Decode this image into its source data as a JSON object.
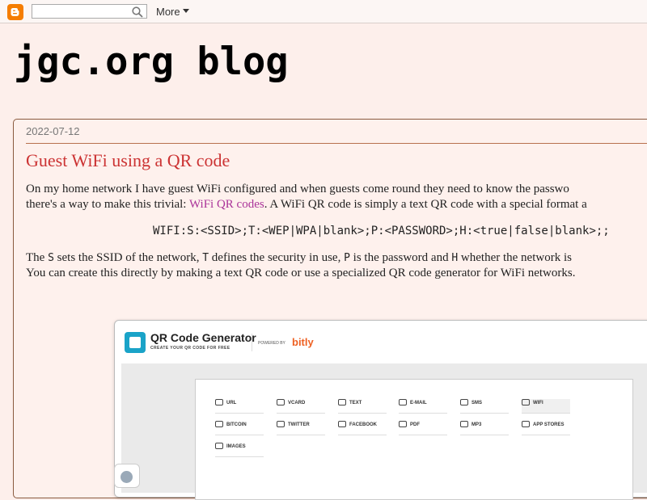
{
  "navbar": {
    "logo_icon": "blogger-icon",
    "search_placeholder": "",
    "more_label": "More"
  },
  "header": {
    "title": "jgc.org blog"
  },
  "post": {
    "date": "2022-07-12",
    "title": "Guest WiFi using a QR code",
    "p1_line1": "On my home network I have guest WiFi configured and when guests come round they need to know the passwo",
    "p1_line2_before": "there's a way to make this trivial: ",
    "p1_link": "WiFi QR codes",
    "p1_line2_after": ". A WiFi QR code is simply a text QR code with a special format a",
    "code": "WIFI:S:<SSID>;T:<WEP|WPA|blank>;P:<PASSWORD>;H:<true|false|blank>;;",
    "p2_t1": "The ",
    "p2_c1": "S",
    "p2_t2": " sets the SSID of the network, ",
    "p2_c2": "T",
    "p2_t3": " defines the security in use, ",
    "p2_c3": "P",
    "p2_t4": " is the password and ",
    "p2_c4": "H",
    "p2_t5": " whether the network is",
    "p2_line2": "You can create this directly by making a text QR code or use a specialized QR code generator for WiFi networks."
  },
  "screenshot": {
    "brand_title": "QR Code Generator",
    "brand_sub": "CREATE YOUR QR CODE FOR FREE",
    "powered_by": "POWERED BY",
    "bitly": "bitly",
    "tabs": [
      {
        "label": "URL",
        "icon": "url-icon"
      },
      {
        "label": "VCARD",
        "icon": "vcard-icon"
      },
      {
        "label": "TEXT",
        "icon": "text-icon"
      },
      {
        "label": "E-MAIL",
        "icon": "email-icon"
      },
      {
        "label": "SMS",
        "icon": "sms-icon"
      },
      {
        "label": "WIFI",
        "icon": "wifi-icon",
        "active": true
      },
      {
        "label": "BITCOIN",
        "icon": "bitcoin-icon"
      },
      {
        "label": "TWITTER",
        "icon": "twitter-icon"
      },
      {
        "label": "FACEBOOK",
        "icon": "facebook-icon"
      },
      {
        "label": "PDF",
        "icon": "pdf-icon"
      },
      {
        "label": "MP3",
        "icon": "mp3-icon"
      },
      {
        "label": "APP STORES",
        "icon": "app-stores-icon"
      },
      {
        "label": "IMAGES",
        "icon": "images-icon"
      }
    ]
  },
  "colors": {
    "background": "#fdefeb",
    "title_red": "#cc3333",
    "link": "#aa3399",
    "blogger_orange": "#f57d00",
    "bitly_orange": "#ee6123"
  }
}
